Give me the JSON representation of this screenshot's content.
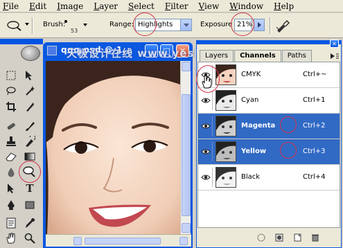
{
  "menu": [
    "File",
    "Edit",
    "Image",
    "Layer",
    "Select",
    "Filter",
    "View",
    "Window",
    "Help"
  ],
  "options": {
    "brush_label": "Brush:",
    "brush_size": "53",
    "range_label": "Range:",
    "range_value": "Highlights",
    "exposure_label": "Exposure",
    "exposure_value": "21%"
  },
  "document": {
    "title": "qqq.psd @ 1...",
    "minimize": "_",
    "maximize": "□",
    "close": "✕"
  },
  "watermark": "天极设计在线 www.yesky.com",
  "panel": {
    "tabs": [
      {
        "label": "Layers"
      },
      {
        "label": "Channels"
      },
      {
        "label": "Paths"
      }
    ],
    "channels": [
      {
        "name": "CMYK",
        "shortcut": "Ctrl+~",
        "selected": false
      },
      {
        "name": "Cyan",
        "shortcut": "Ctrl+1",
        "selected": false
      },
      {
        "name": "Magenta",
        "shortcut": "Ctrl+2",
        "selected": true
      },
      {
        "name": "Yellow",
        "shortcut": "Ctrl+3",
        "selected": true
      },
      {
        "name": "Black",
        "shortcut": "Ctrl+4",
        "selected": false
      }
    ]
  },
  "colors": {
    "xp_blue": "#0a58e0",
    "selection": "#316ac5",
    "annotation_red": "#d0334a",
    "chrome": "#ece9d8"
  }
}
